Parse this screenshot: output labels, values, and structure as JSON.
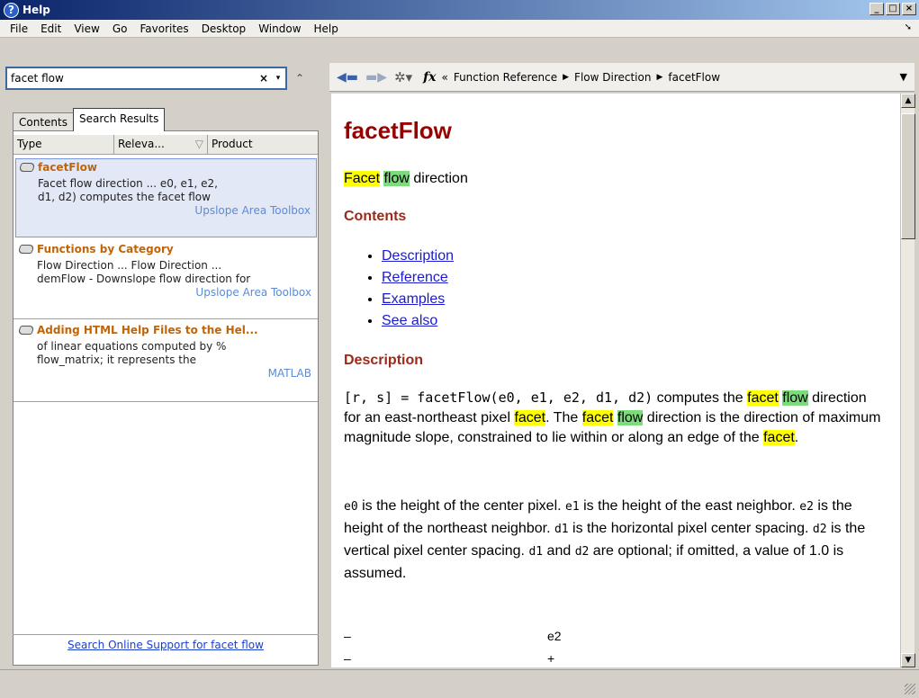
{
  "window": {
    "title": "Help"
  },
  "menu": [
    "File",
    "Edit",
    "View",
    "Go",
    "Favorites",
    "Desktop",
    "Window",
    "Help"
  ],
  "search": {
    "value": "facet flow"
  },
  "tabs": {
    "contents": "Contents",
    "search_results": "Search Results"
  },
  "columns": {
    "type": "Type",
    "relevance": "Releva...",
    "product": "Product"
  },
  "results": [
    {
      "title": "facetFlow",
      "snippet1": "Facet flow direction ... e0, e1, e2,",
      "snippet2": "d1, d2) computes the facet flow",
      "product": "Upslope Area Toolbox"
    },
    {
      "title": "Functions by Category",
      "snippet1": "Flow Direction ... Flow Direction ...",
      "snippet2": "demFlow - Downslope flow direction for",
      "product": "Upslope Area Toolbox"
    },
    {
      "title": "Adding HTML Help Files to the Hel...",
      "snippet1": "of linear equations computed by %",
      "snippet2": "flow_matrix; it represents the",
      "product": "MATLAB"
    }
  ],
  "online_link": "Search Online Support for facet flow",
  "breadcrumb": [
    "Function Reference",
    "Flow Direction",
    "facetFlow"
  ],
  "doc": {
    "title": "facetFlow",
    "contents_heading": "Contents",
    "links": [
      "Description",
      "Reference",
      "Examples",
      "See also"
    ],
    "description_heading": "Description",
    "code_lines": [
      "–",
      "–"
    ],
    "code_right": [
      "e2",
      "+"
    ]
  }
}
